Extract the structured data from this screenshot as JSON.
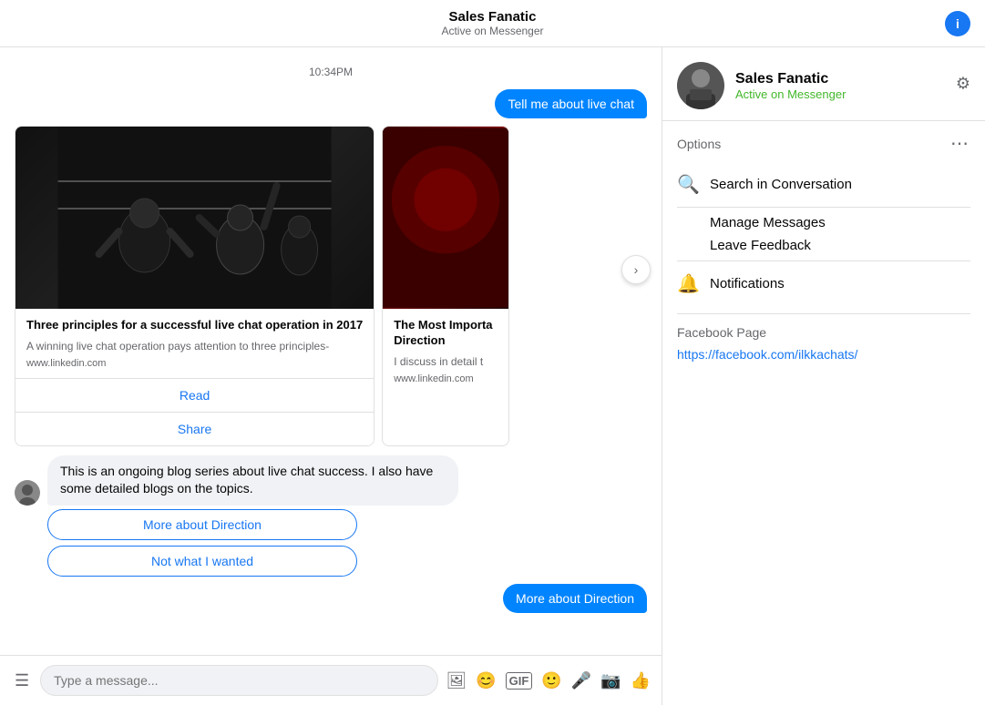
{
  "header": {
    "title": "Sales Fanatic",
    "status": "Active on Messenger",
    "info_icon": "i"
  },
  "timestamp": "10:34PM",
  "chat": {
    "sent_bubble": "Tell me about live chat",
    "cards": [
      {
        "title": "Three principles for a successful live chat operation in 2017",
        "desc": "A winning live chat operation pays attention to three principles-",
        "domain": "www.linkedin.com",
        "btn1": "Read",
        "btn2": "Share"
      },
      {
        "title": "The Most Importa Direction",
        "desc": "I discuss in detail t",
        "domain": "www.linkedin.com"
      }
    ],
    "bot_message": "This is an ongoing blog series about live chat success. I also have some detailed blogs on the topics.",
    "quick_reply_1": "More about Direction",
    "quick_reply_2": "Not what I wanted",
    "sent_action": "More about Direction"
  },
  "input": {
    "placeholder": "Type a message..."
  },
  "sidebar": {
    "profile_name": "Sales Fanatic",
    "profile_status": "Active on Messenger",
    "options_title": "Options",
    "search_label": "Search in Conversation",
    "manage_label": "Manage Messages",
    "feedback_label": "Leave Feedback",
    "notifications_label": "Notifications",
    "fb_page_title": "Facebook Page",
    "fb_page_link": "https://facebook.com/ilkkachats/"
  }
}
